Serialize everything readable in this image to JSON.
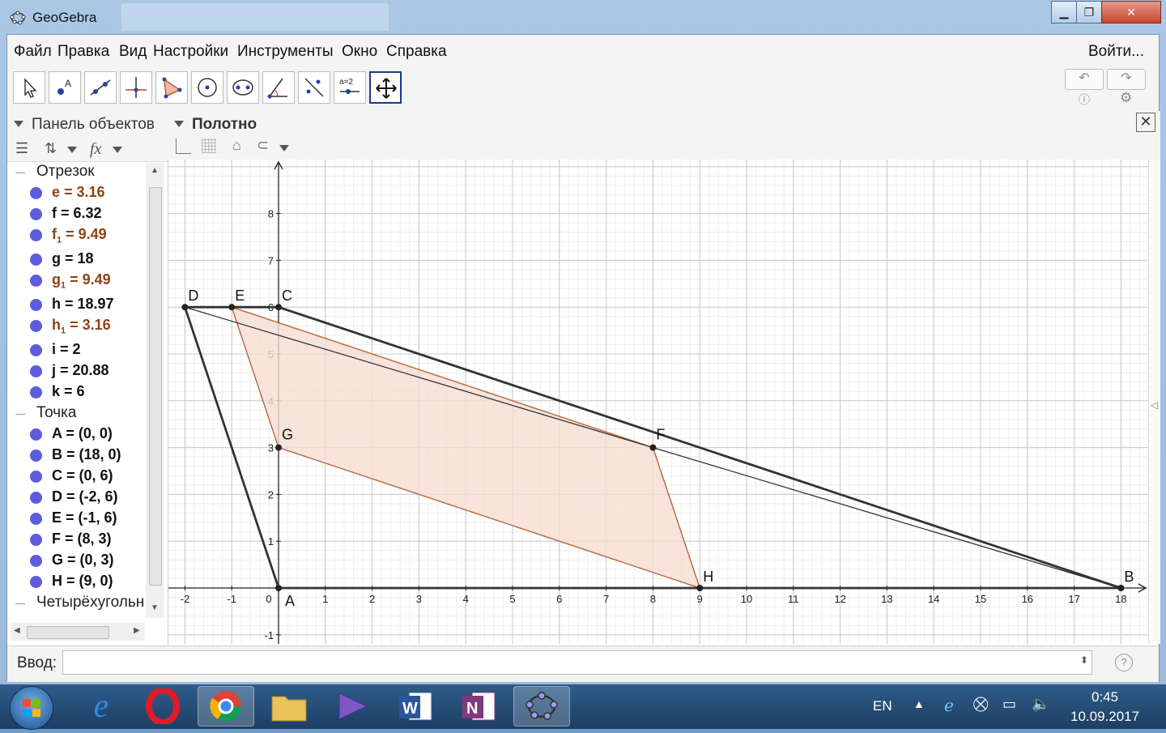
{
  "window": {
    "title": "GeoGebra"
  },
  "menu": {
    "items": [
      "Файл",
      "Правка",
      "Вид",
      "Настройки",
      "Инструменты",
      "Окно",
      "Справка"
    ],
    "login": "Войти..."
  },
  "panel": {
    "title": "Панель объектов",
    "fx_label": "fx",
    "groups": [
      {
        "name": "Отрезок"
      },
      {
        "name": "Точка"
      },
      {
        "name": "Четырёхугольн"
      }
    ],
    "objects": [
      {
        "main": "e = 3.16",
        "color": "#8b4513"
      },
      {
        "main": "f = 6.32",
        "color": "#111111"
      },
      {
        "main": "f",
        "sub": "1",
        "rest": " = 9.49",
        "color": "#8b4513"
      },
      {
        "main": "g = 18",
        "color": "#111111"
      },
      {
        "main": "g",
        "sub": "1",
        "rest": " = 9.49",
        "color": "#8b4513"
      },
      {
        "main": "h = 18.97",
        "color": "#111111"
      },
      {
        "main": "h",
        "sub": "1",
        "rest": " = 3.16",
        "color": "#8b4513"
      },
      {
        "main": "i = 2",
        "color": "#111111"
      },
      {
        "main": "j = 20.88",
        "color": "#111111"
      },
      {
        "main": "k = 6",
        "color": "#111111"
      },
      {
        "main": "A = (0, 0)",
        "color": "#111111"
      },
      {
        "main": "B = (18, 0)",
        "color": "#111111"
      },
      {
        "main": "C = (0, 6)",
        "color": "#111111"
      },
      {
        "main": "D = (-2, 6)",
        "color": "#111111"
      },
      {
        "main": "E = (-1, 6)",
        "color": "#111111"
      },
      {
        "main": "F = (8, 3)",
        "color": "#111111"
      },
      {
        "main": "G = (0, 3)",
        "color": "#111111"
      },
      {
        "main": "H = (9, 0)",
        "color": "#111111"
      }
    ]
  },
  "canvas": {
    "title": "Полотно",
    "x_ticks": [
      "-2",
      "-1",
      "0",
      "1",
      "2",
      "3",
      "4",
      "5",
      "6",
      "7",
      "8",
      "9",
      "10",
      "11",
      "12",
      "13",
      "14",
      "15",
      "16",
      "17",
      "18"
    ],
    "y_ticks": [
      "-1",
      "1",
      "2",
      "3",
      "4",
      "5",
      "6",
      "7",
      "8"
    ],
    "points": [
      {
        "label": "A",
        "x": 0,
        "y": 0
      },
      {
        "label": "B",
        "x": 18,
        "y": 0
      },
      {
        "label": "C",
        "x": 0,
        "y": 6
      },
      {
        "label": "D",
        "x": -2,
        "y": 6
      },
      {
        "label": "E",
        "x": -1,
        "y": 6
      },
      {
        "label": "F",
        "x": 8,
        "y": 3
      },
      {
        "label": "G",
        "x": 0,
        "y": 3
      },
      {
        "label": "H",
        "x": 9,
        "y": 0
      }
    ],
    "quad_outer": [
      "A",
      "B",
      "C",
      "D"
    ],
    "quad_inner": [
      "E",
      "F",
      "H",
      "G"
    ],
    "diagonal": [
      "D",
      "B"
    ],
    "colors": {
      "outer": "#333333",
      "inner": "#b5683a",
      "fill": "#f5ddd2",
      "point": "#222222"
    }
  },
  "input": {
    "label": "Ввод:",
    "help": "?"
  },
  "taskbar": {
    "lang": "EN",
    "time": "0:45",
    "date": "10.09.2017"
  }
}
